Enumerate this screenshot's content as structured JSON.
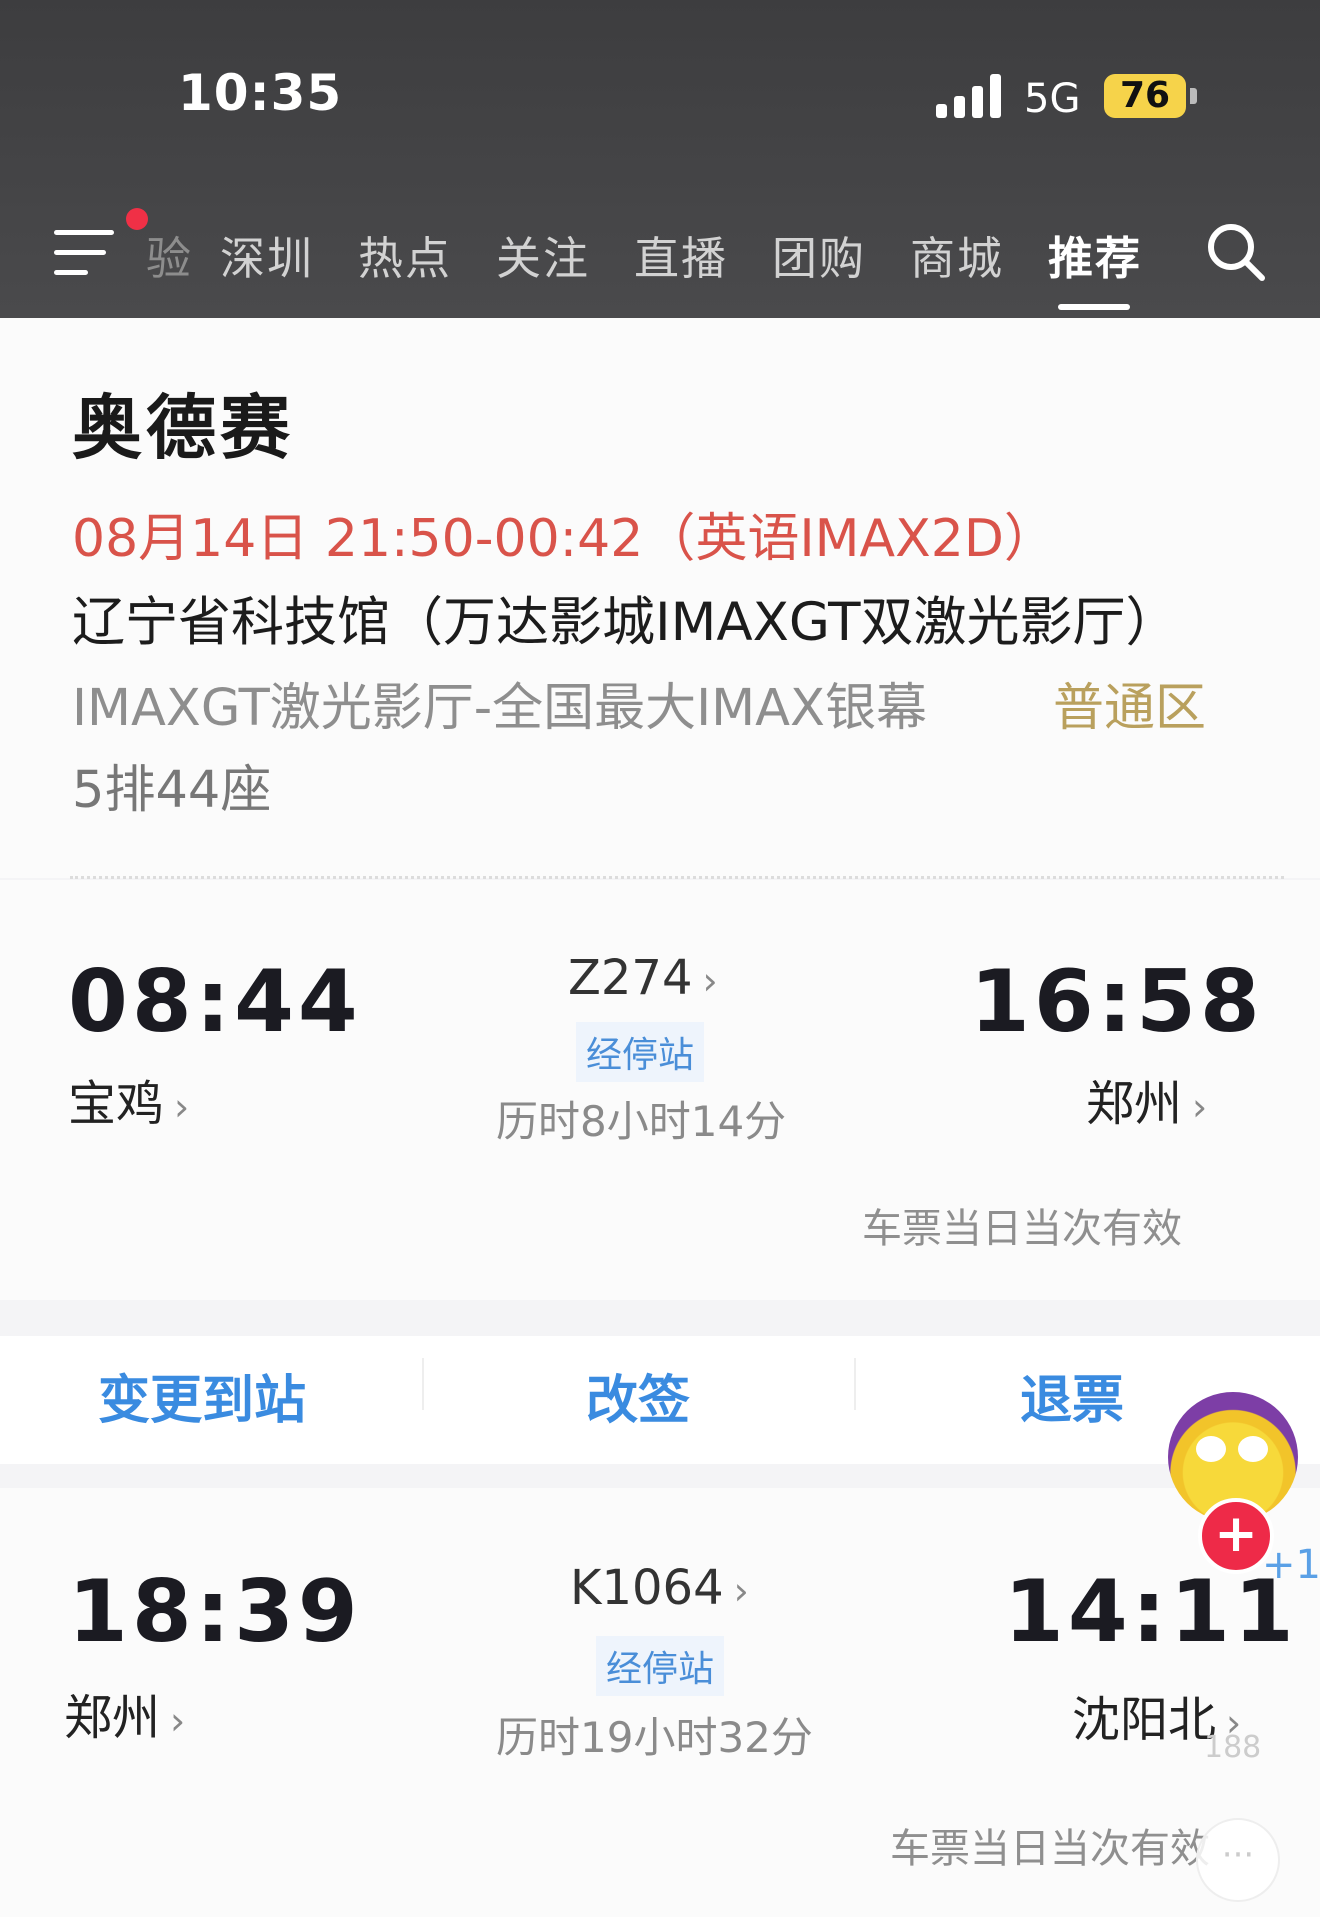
{
  "status_bar": {
    "time": "10:35",
    "network": "5G",
    "battery": "76"
  },
  "nav": {
    "partial_tab": "验",
    "tabs": [
      {
        "label": "深圳"
      },
      {
        "label": "热点"
      },
      {
        "label": "关注"
      },
      {
        "label": "直播"
      },
      {
        "label": "团购"
      },
      {
        "label": "商城"
      },
      {
        "label": "推荐"
      }
    ],
    "active_tab": "推荐"
  },
  "movie": {
    "title": "奥德赛",
    "showtime": "08月14日 21:50-00:42（英语IMAX2D）",
    "venue": "辽宁省科技馆（万达影城IMAXGT双激光影厅）",
    "hall": "IMAXGT激光影厅-全国最大IMAX银幕",
    "zone": "普通区",
    "seat": "5排44座"
  },
  "trains": [
    {
      "depart_time": "08:44",
      "depart_station": "宝鸡",
      "train_no": "Z274",
      "stops_label": "经停站",
      "duration": "历时8小时14分",
      "arrive_time": "16:58",
      "arrive_station": "郑州",
      "validity": "车票当日当次有效"
    },
    {
      "depart_time": "18:39",
      "depart_station": "郑州",
      "train_no": "K1064",
      "stops_label": "经停站",
      "duration": "历时19小时32分",
      "arrive_time": "14:11",
      "arrive_station": "沈阳北",
      "validity": "车票当日当次有效"
    }
  ],
  "actions": {
    "change_station": "变更到站",
    "reschedule": "改签",
    "refund": "退票"
  },
  "overlay": {
    "plus_one": "+1",
    "follow": "+",
    "like_count": "188",
    "comment": "···"
  },
  "colors": {
    "accent_blue": "#3a8be0",
    "showtime_red": "#d9534a",
    "zone_gold": "#b9a05d",
    "battery_yellow": "#f6d34a",
    "notify_red": "#f03046"
  }
}
